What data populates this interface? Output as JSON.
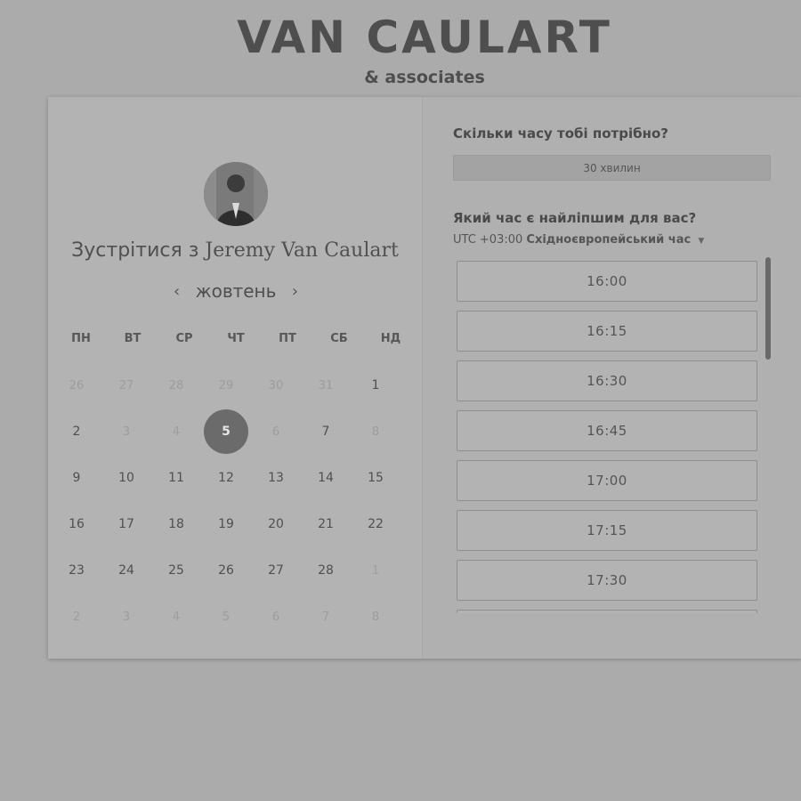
{
  "brand": {
    "title": "VAN CAULART",
    "subtitle": "& associates"
  },
  "left": {
    "meet_prefix": "Зустрітися з",
    "host_name": "Jeremy Van Caulart",
    "avatar_icon": "person-photo",
    "month": "жовтень",
    "prev_icon": "chevron-left-icon",
    "next_icon": "chevron-right-icon",
    "prev_glyph": "‹",
    "next_glyph": "›",
    "weekdays": [
      "ПН",
      "ВТ",
      "СР",
      "ЧТ",
      "ПТ",
      "СБ",
      "НД"
    ],
    "days": [
      {
        "label": "26",
        "state": "muted"
      },
      {
        "label": "27",
        "state": "muted"
      },
      {
        "label": "28",
        "state": "muted"
      },
      {
        "label": "29",
        "state": "muted"
      },
      {
        "label": "30",
        "state": "muted"
      },
      {
        "label": "31",
        "state": "muted"
      },
      {
        "label": "1",
        "state": "normal"
      },
      {
        "label": "2",
        "state": "normal"
      },
      {
        "label": "3",
        "state": "muted"
      },
      {
        "label": "4",
        "state": "muted"
      },
      {
        "label": "5",
        "state": "selected"
      },
      {
        "label": "6",
        "state": "muted"
      },
      {
        "label": "7",
        "state": "normal"
      },
      {
        "label": "8",
        "state": "muted"
      },
      {
        "label": "9",
        "state": "normal"
      },
      {
        "label": "10",
        "state": "normal"
      },
      {
        "label": "11",
        "state": "normal"
      },
      {
        "label": "12",
        "state": "normal"
      },
      {
        "label": "13",
        "state": "normal"
      },
      {
        "label": "14",
        "state": "normal"
      },
      {
        "label": "15",
        "state": "normal"
      },
      {
        "label": "16",
        "state": "normal"
      },
      {
        "label": "17",
        "state": "normal"
      },
      {
        "label": "18",
        "state": "normal"
      },
      {
        "label": "19",
        "state": "normal"
      },
      {
        "label": "20",
        "state": "normal"
      },
      {
        "label": "21",
        "state": "normal"
      },
      {
        "label": "22",
        "state": "normal"
      },
      {
        "label": "23",
        "state": "normal"
      },
      {
        "label": "24",
        "state": "normal"
      },
      {
        "label": "25",
        "state": "normal"
      },
      {
        "label": "26",
        "state": "normal"
      },
      {
        "label": "27",
        "state": "normal"
      },
      {
        "label": "28",
        "state": "normal"
      },
      {
        "label": "1",
        "state": "muted"
      },
      {
        "label": "2",
        "state": "muted"
      },
      {
        "label": "3",
        "state": "muted"
      },
      {
        "label": "4",
        "state": "muted"
      },
      {
        "label": "5",
        "state": "muted"
      },
      {
        "label": "6",
        "state": "muted"
      },
      {
        "label": "7",
        "state": "muted"
      },
      {
        "label": "8",
        "state": "muted"
      }
    ]
  },
  "right": {
    "duration_question": "Скільки часу тобі потрібно?",
    "duration_value": "30 хвилин",
    "time_question": "Який час є найліпшим для вас?",
    "tz_offset": "UTC +03:00",
    "tz_name": "Східноєвропейський час",
    "tz_caret": "▼",
    "slots": [
      "16:00",
      "16:15",
      "16:30",
      "16:45",
      "17:00",
      "17:15",
      "17:30",
      ""
    ]
  },
  "colors": {
    "background": "#ababab",
    "selected_day": "#6b6b6b"
  }
}
